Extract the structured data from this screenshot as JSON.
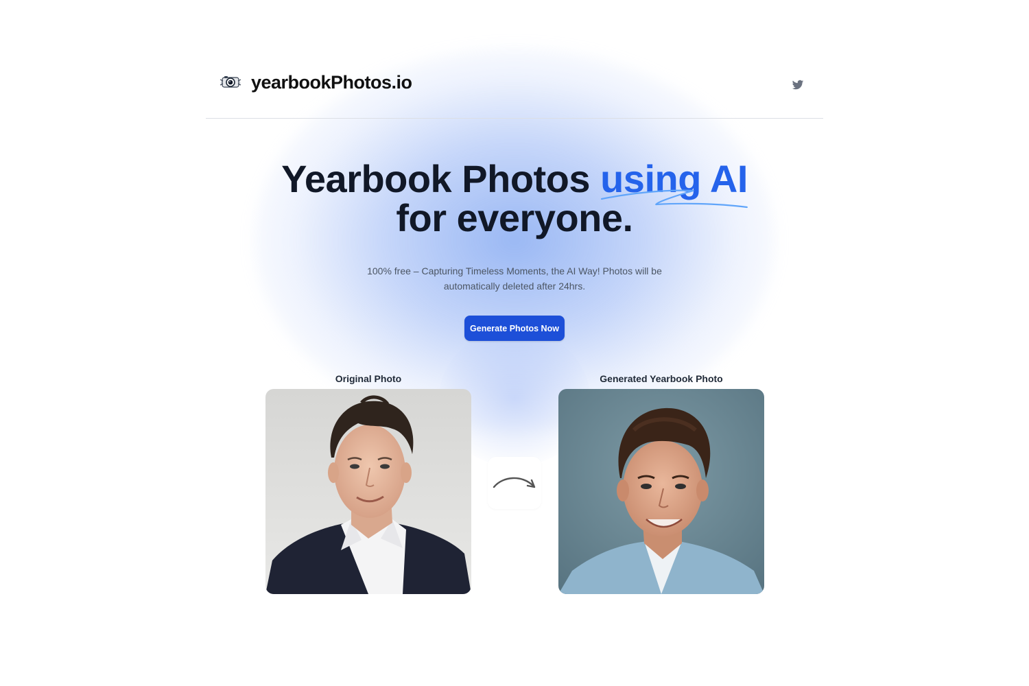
{
  "header": {
    "brand_name": "yearbookPhotos.io",
    "logo_icon": "camera-lens-icon",
    "social_icon": "twitter-icon"
  },
  "hero": {
    "title_part1": "Yearbook Photos ",
    "title_accent": "using AI",
    "title_part2": "for everyone.",
    "subtitle": "100% free – Capturing Timeless Moments, the AI Way! Photos will be automatically deleted after 24hrs.",
    "cta_label": "Generate Photos Now"
  },
  "comparison": {
    "original_caption": "Original Photo",
    "generated_caption": "Generated Yearbook Photo",
    "arrow_icon": "curved-arrow-right-icon"
  },
  "colors": {
    "accent": "#2563eb",
    "button": "#1d4fd8",
    "heading": "#111827"
  }
}
